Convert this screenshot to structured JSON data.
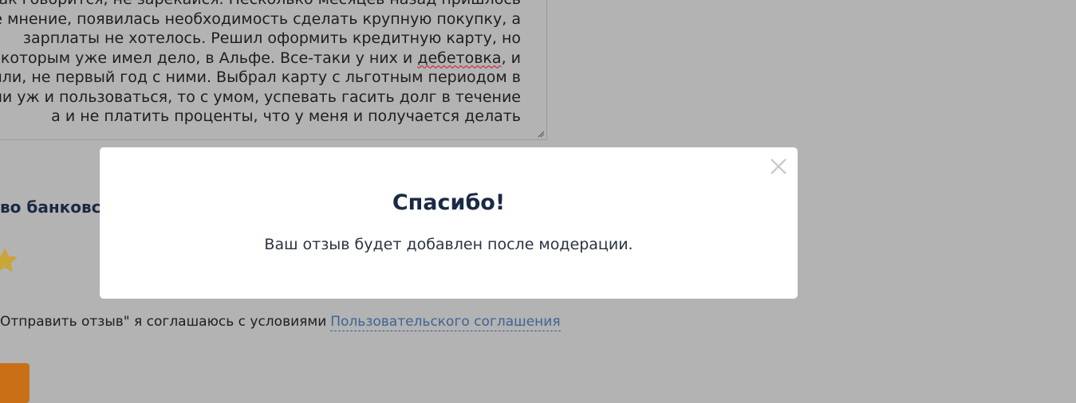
{
  "review": {
    "lines": [
      "как говорится, не зарекайся. Несколько месяцев назад пришлось",
      "е мнение, появилась необходимость сделать крупную покупку, а",
      "зарплаты не хотелось. Решил оформить кредитную карту, но",
      "которым уже имел дело, в Альфе. Все-таки у них и ",
      "были, не первый год с ними. Выбрал карту с льготным периодом в",
      "ли уж и пользоваться, то с умом, успевать гасить долг в течение",
      "а и не платить проценты, что у меня и получается делать"
    ],
    "misspelled_word": "дебетовка",
    "line4_tail": ", и"
  },
  "rating": {
    "heading": "во банковск",
    "star_icon": "star-icon"
  },
  "agreement": {
    "text": "Отправить отзыв\" я соглашаюсь с условиями",
    "link_label": "Пользовательского соглашения"
  },
  "modal": {
    "title": "Спасибо!",
    "message": "Ваш отзыв будет добавлен после модерации.",
    "close_icon": "close-icon"
  },
  "colors": {
    "overlay": "#b3b3b3",
    "submit_button": "#c97017",
    "link": "#3f6396",
    "heading": "#1b2a44"
  }
}
